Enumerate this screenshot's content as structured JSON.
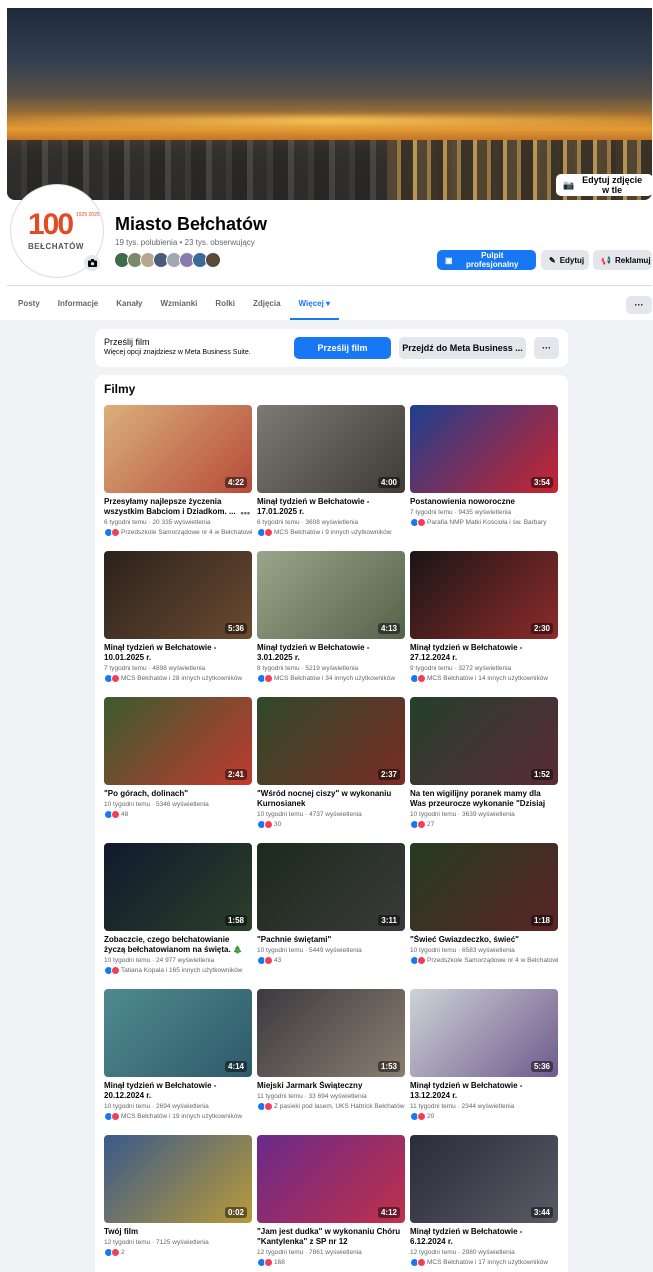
{
  "page": {
    "name": "Miasto Bełchatów",
    "stats": "19 tys. polubienia • 23 tys. obserwujący",
    "logo_number": "100",
    "logo_years": "1925 2025",
    "logo_text": "BEŁCHATÓW",
    "edit_cover_label": "Edytuj zdjęcie w tle",
    "buttons": {
      "pro": "Pulpit profesjonalny",
      "edit": "Edytuj",
      "ads": "Reklamuj"
    }
  },
  "tabs": [
    {
      "label": "Posty"
    },
    {
      "label": "Informacje"
    },
    {
      "label": "Kanały"
    },
    {
      "label": "Wzmianki"
    },
    {
      "label": "Rolki"
    },
    {
      "label": "Zdjęcia"
    },
    {
      "label": "Więcej ▾"
    }
  ],
  "tab_more_label": "···",
  "upload": {
    "title": "Prześlij film",
    "subtitle": "Więcej opcji znajdziesz w Meta Business Suite.",
    "upload_button": "Prześlij film",
    "mbs_button": "Przejdź do Meta Business ...",
    "more_label": "···"
  },
  "videos_section_title": "Filmy",
  "videos": [
    {
      "title": "Przesyłamy najlepsze życzenia wszystkim Babciom i Dziadkom. ...",
      "duration": "4:22",
      "meta": "6 tygodni temu · 20 335 wyświetlenia",
      "reactions": "Przedszkole Samorządowe nr 4 w Bełchatowie",
      "colors": [
        "#d9b07a",
        "#b84a3a"
      ],
      "more": "•••"
    },
    {
      "title": "Minął tydzień w Bełchatowie - 17.01.2025 r.",
      "duration": "4:00",
      "meta": "6 tygodni temu · 3608 wyświetlenia",
      "reactions": "MCS Bełchatów i 9 innych użytkowników",
      "colors": [
        "#7c7a73",
        "#3f3b36"
      ]
    },
    {
      "title": "Postanowienia noworoczne",
      "duration": "3:54",
      "meta": "7 tygodni temu · 9435 wyświetlenia",
      "reactions": "Parafia NMP Matki Kościoła i św. Barbary",
      "colors": [
        "#1e3f8f",
        "#c9232e"
      ]
    },
    {
      "title": "Minął tydzień w Bełchatowie - 10.01.2025 r.",
      "duration": "5:36",
      "meta": "7 tygodni temu · 4898 wyświetlenia",
      "reactions": "MCS Bełchatów i 28 innych użytkowników",
      "colors": [
        "#2a221d",
        "#6b4a2f"
      ]
    },
    {
      "title": "Minął tydzień w Bełchatowie - 3.01.2025 r.",
      "duration": "4:13",
      "meta": "8 tygodni temu · 5219 wyświetlenia",
      "reactions": "MCS Bełchatów i 34 innych użytkowników",
      "colors": [
        "#9aa58a",
        "#55624a"
      ]
    },
    {
      "title": "Minął tydzień w Bełchatowie - 27.12.2024 r.",
      "duration": "2:30",
      "meta": "9 tygodni temu · 3272 wyświetlenia",
      "reactions": "MCS Bełchatów i 14 innych użytkowników",
      "colors": [
        "#1a1616",
        "#8e2a2a"
      ]
    },
    {
      "title": "\"Po górach, dolinach\"",
      "duration": "2:41",
      "meta": "10 tygodni temu · 5346 wyświetlenia",
      "reactions": "48",
      "colors": [
        "#3b5b2e",
        "#c03a30"
      ]
    },
    {
      "title": "\"Wśród nocnej ciszy\" w wykonaniu Kurnosianek",
      "duration": "2:37",
      "meta": "10 tygodni temu · 4737 wyświetlenia",
      "reactions": "30",
      "colors": [
        "#2f4a2a",
        "#7a2b25"
      ]
    },
    {
      "title": "Na ten wigilijny poranek mamy dla Was przeurocze wykonanie \"Dzisiaj w...",
      "duration": "1:52",
      "meta": "10 tygodni temu · 3639 wyświetlenia",
      "reactions": "27",
      "colors": [
        "#24402a",
        "#5a2a3a"
      ]
    },
    {
      "title": "Zobaczcie, czego bełchatowianie życzą bełchatowianom na święta. 🎄",
      "duration": "1:58",
      "meta": "10 tygodni temu · 24 977 wyświetlenia",
      "reactions": "Tatiana Kopala i 165 innych użytkowników",
      "colors": [
        "#101a2c",
        "#2c3f2a"
      ]
    },
    {
      "title": "\"Pachnie świętami\"",
      "duration": "3:11",
      "meta": "10 tygodni temu · 5449 wyświetlenia",
      "reactions": "43",
      "colors": [
        "#1c2a1c",
        "#3a3a3a"
      ]
    },
    {
      "title": "\"Świeć Gwiazdeczko, świeć\"",
      "duration": "1:18",
      "meta": "10 tygodni temu · 6583 wyświetlenia",
      "reactions": "Przedszkole Samorządowe nr 4 w Bełchatowie",
      "colors": [
        "#253b24",
        "#5a2424"
      ]
    },
    {
      "title": "Minął tydzień w Bełchatowie - 20.12.2024 r.",
      "duration": "4:14",
      "meta": "10 tygodni temu · 2694 wyświetlenia",
      "reactions": "MCS Bełchatów i 19 innych użytkowników",
      "colors": [
        "#4f8a8f",
        "#2e5a6a"
      ]
    },
    {
      "title": "Miejski Jarmark Świąteczny",
      "duration": "1:53",
      "meta": "11 tygodni temu · 33 694 wyświetlenia",
      "reactions": "Z pasieki pod lasem, UKS Hattrick Bełchatów",
      "colors": [
        "#3c3a3f",
        "#8a7d70"
      ]
    },
    {
      "title": "Minął tydzień w Bełchatowie - 13.12.2024 r.",
      "duration": "5:36",
      "meta": "11 tygodni temu · 2344 wyświetlenia",
      "reactions": "20",
      "colors": [
        "#cfd3d8",
        "#6e5a8c"
      ]
    },
    {
      "title": "Twój film",
      "duration": "0:02",
      "meta": "12 tygodni temu · 7125 wyświetlenia",
      "reactions": "2",
      "colors": [
        "#3a5a8a",
        "#b89a3a"
      ]
    },
    {
      "title": "\"Jam jest dudka\" w wykonaniu Chóru \"Kantylenka\" z SP nr 12",
      "duration": "4:12",
      "meta": "12 tygodni temu · 7861 wyświetlenia",
      "reactions": "168",
      "colors": [
        "#6a2a8a",
        "#c0304a"
      ]
    },
    {
      "title": "Minął tydzień w Bełchatowie - 6.12.2024 r.",
      "duration": "3:44",
      "meta": "12 tygodni temu · 2980 wyświetlenia",
      "reactions": "MCS Bełchatów i 17 innych użytkowników",
      "colors": [
        "#2a2c3a",
        "#5a5a66"
      ]
    }
  ]
}
